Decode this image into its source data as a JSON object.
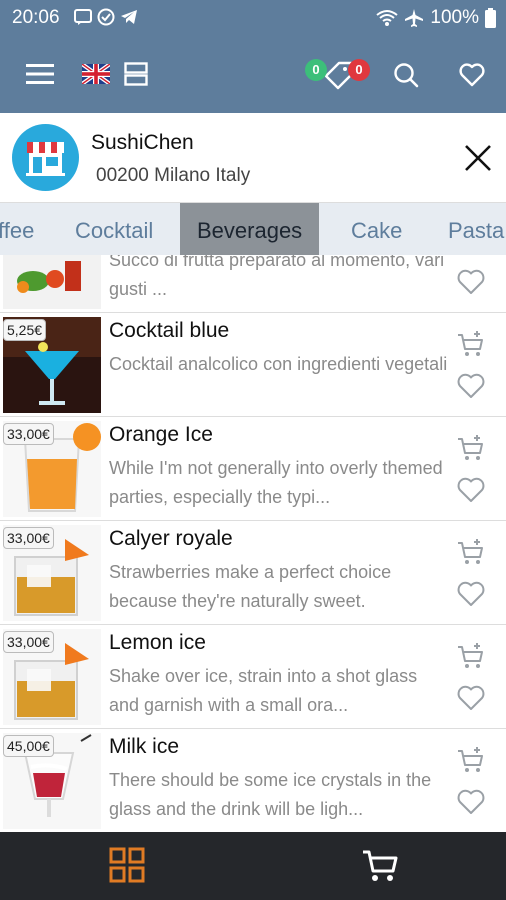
{
  "status_bar": {
    "time": "20:06",
    "battery": "100%",
    "icons": [
      "message-icon",
      "check-circle-icon",
      "telegram-icon",
      "wifi-icon",
      "airplane-icon",
      "battery-icon"
    ]
  },
  "app_bar": {
    "compare_count": "0",
    "tag_count": "0",
    "icons": [
      "menu-icon",
      "uk-flag-icon",
      "layout-icon",
      "tag-icon",
      "search-icon",
      "heart-icon"
    ],
    "colors": {
      "bar": "#5e7d9c",
      "green_badge": "#3cbf7a",
      "red_badge": "#e0383e"
    }
  },
  "store": {
    "name": "SushiChen",
    "address": "00200 Milano Italy"
  },
  "categories": {
    "tabs": [
      "ffee",
      "Cocktail",
      "Beverages",
      "Cake",
      "Pasta"
    ],
    "selected": "Beverages"
  },
  "products": [
    {
      "title": "",
      "price": "",
      "description": "Succo di frutta preparato al momento, vari gusti ..."
    },
    {
      "title": "Cocktail blue",
      "price": "5,25€",
      "description": "Cocktail analcolico con ingredienti vegetali"
    },
    {
      "title": "Orange Ice",
      "price": "33,00€",
      "description": "While I'm not generally into overly themed parties, especially the typi..."
    },
    {
      "title": "Calyer royale",
      "price": "33,00€",
      "description": "Strawberries make a perfect choice because they're naturally sweet."
    },
    {
      "title": "Lemon ice",
      "price": "33,00€",
      "description": "Shake over ice, strain into a shot glass and garnish with a small ora..."
    },
    {
      "title": "Milk ice",
      "price": "45,00€",
      "description": "There should be some ice crystals in the glass and the drink will be ligh..."
    }
  ],
  "bottom_nav": {
    "items": [
      "grid-icon",
      "cart-icon"
    ],
    "active_color": "#e07b24"
  }
}
